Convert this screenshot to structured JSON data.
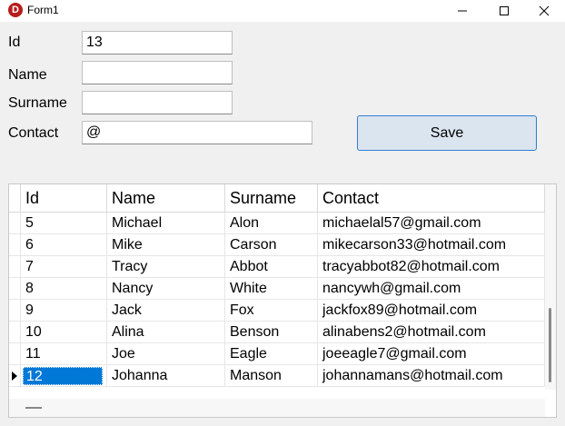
{
  "window": {
    "title": "Form1",
    "icon_letter": "D"
  },
  "form": {
    "fields": [
      {
        "label": "Id",
        "value": "13"
      },
      {
        "label": "Name",
        "value": ""
      },
      {
        "label": "Surname",
        "value": ""
      },
      {
        "label": "Contact",
        "value": "@"
      }
    ],
    "save_label": "Save"
  },
  "grid": {
    "columns": [
      "Id",
      "Name",
      "Surname",
      "Contact"
    ],
    "rows": [
      {
        "id": "5",
        "name": "Michael",
        "surname": "Alon",
        "contact": "michaelal57@gmail.com"
      },
      {
        "id": "6",
        "name": "Mike",
        "surname": "Carson",
        "contact": "mikecarson33@hotmail.com"
      },
      {
        "id": "7",
        "name": "Tracy",
        "surname": "Abbot",
        "contact": "tracyabbot82@hotmail.com"
      },
      {
        "id": "8",
        "name": "Nancy",
        "surname": "White",
        "contact": "nancywh@gmail.com"
      },
      {
        "id": "9",
        "name": "Jack",
        "surname": "Fox",
        "contact": "jackfox89@hotmail.com"
      },
      {
        "id": "10",
        "name": "Alina",
        "surname": "Benson",
        "contact": "alinabens2@hotmail.com"
      },
      {
        "id": "11",
        "name": "Joe",
        "surname": "Eagle",
        "contact": "joeeagle7@gmail.com"
      },
      {
        "id": "12",
        "name": "Johanna",
        "surname": "Manson",
        "contact": "johannamans@hotmail.com"
      }
    ],
    "selected_row_id": "12"
  },
  "colors": {
    "accent": "#0078d7",
    "save_bg": "#dae5f0",
    "save_border": "#2f7fd1",
    "icon": "#b71c1c"
  }
}
